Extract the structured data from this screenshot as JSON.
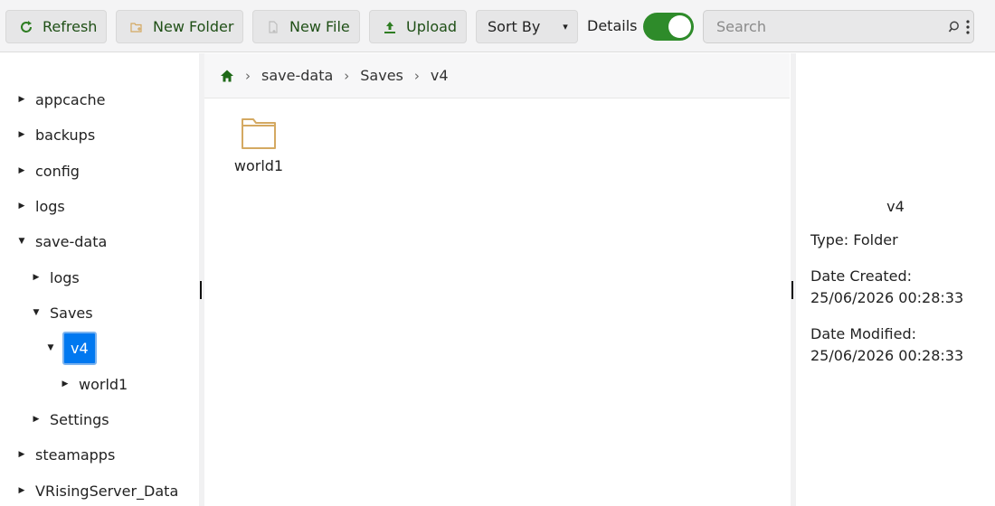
{
  "toolbar": {
    "refresh": {
      "label": "Refresh",
      "icon": "refresh-icon"
    },
    "new_folder": {
      "label": "New Folder",
      "icon": "new-folder-icon"
    },
    "new_file": {
      "label": "New File",
      "icon": "new-file-icon"
    },
    "upload": {
      "label": "Upload",
      "icon": "upload-icon"
    },
    "sort_by": {
      "label": "Sort By",
      "caret": "▾"
    },
    "details": {
      "label": "Details",
      "enabled": true
    },
    "search": {
      "placeholder": "Search",
      "value": ""
    }
  },
  "tree": {
    "items": [
      {
        "label": "appcache",
        "expanded": false
      },
      {
        "label": "backups",
        "expanded": false
      },
      {
        "label": "config",
        "expanded": false
      },
      {
        "label": "logs",
        "expanded": false
      },
      {
        "label": "save-data",
        "expanded": true
      },
      {
        "label": "logs",
        "expanded": false
      },
      {
        "label": "Saves",
        "expanded": true
      },
      {
        "label": "v4",
        "expanded": true,
        "selected": true
      },
      {
        "label": "world1",
        "expanded": false
      },
      {
        "label": "Settings",
        "expanded": false
      },
      {
        "label": "steamapps",
        "expanded": false
      },
      {
        "label": "VRisingServer_Data",
        "expanded": false
      }
    ]
  },
  "breadcrumb": {
    "home_icon": "home-icon",
    "separator": "›",
    "items": [
      "save-data",
      "Saves",
      "v4"
    ]
  },
  "content": {
    "files": [
      {
        "name": "world1",
        "type": "folder",
        "icon": "folder-icon"
      }
    ]
  },
  "details_panel": {
    "title": "v4",
    "type_line": "Type: Folder",
    "created_label": "Date Created:",
    "created_value": "25/06/2026 00:28:33",
    "modified_label": "Date Modified:",
    "modified_value": "25/06/2026 00:28:33"
  },
  "colors": {
    "accent_green": "#2e8b2a",
    "selected_blue": "#0078f0",
    "folder": "#d4a962"
  }
}
